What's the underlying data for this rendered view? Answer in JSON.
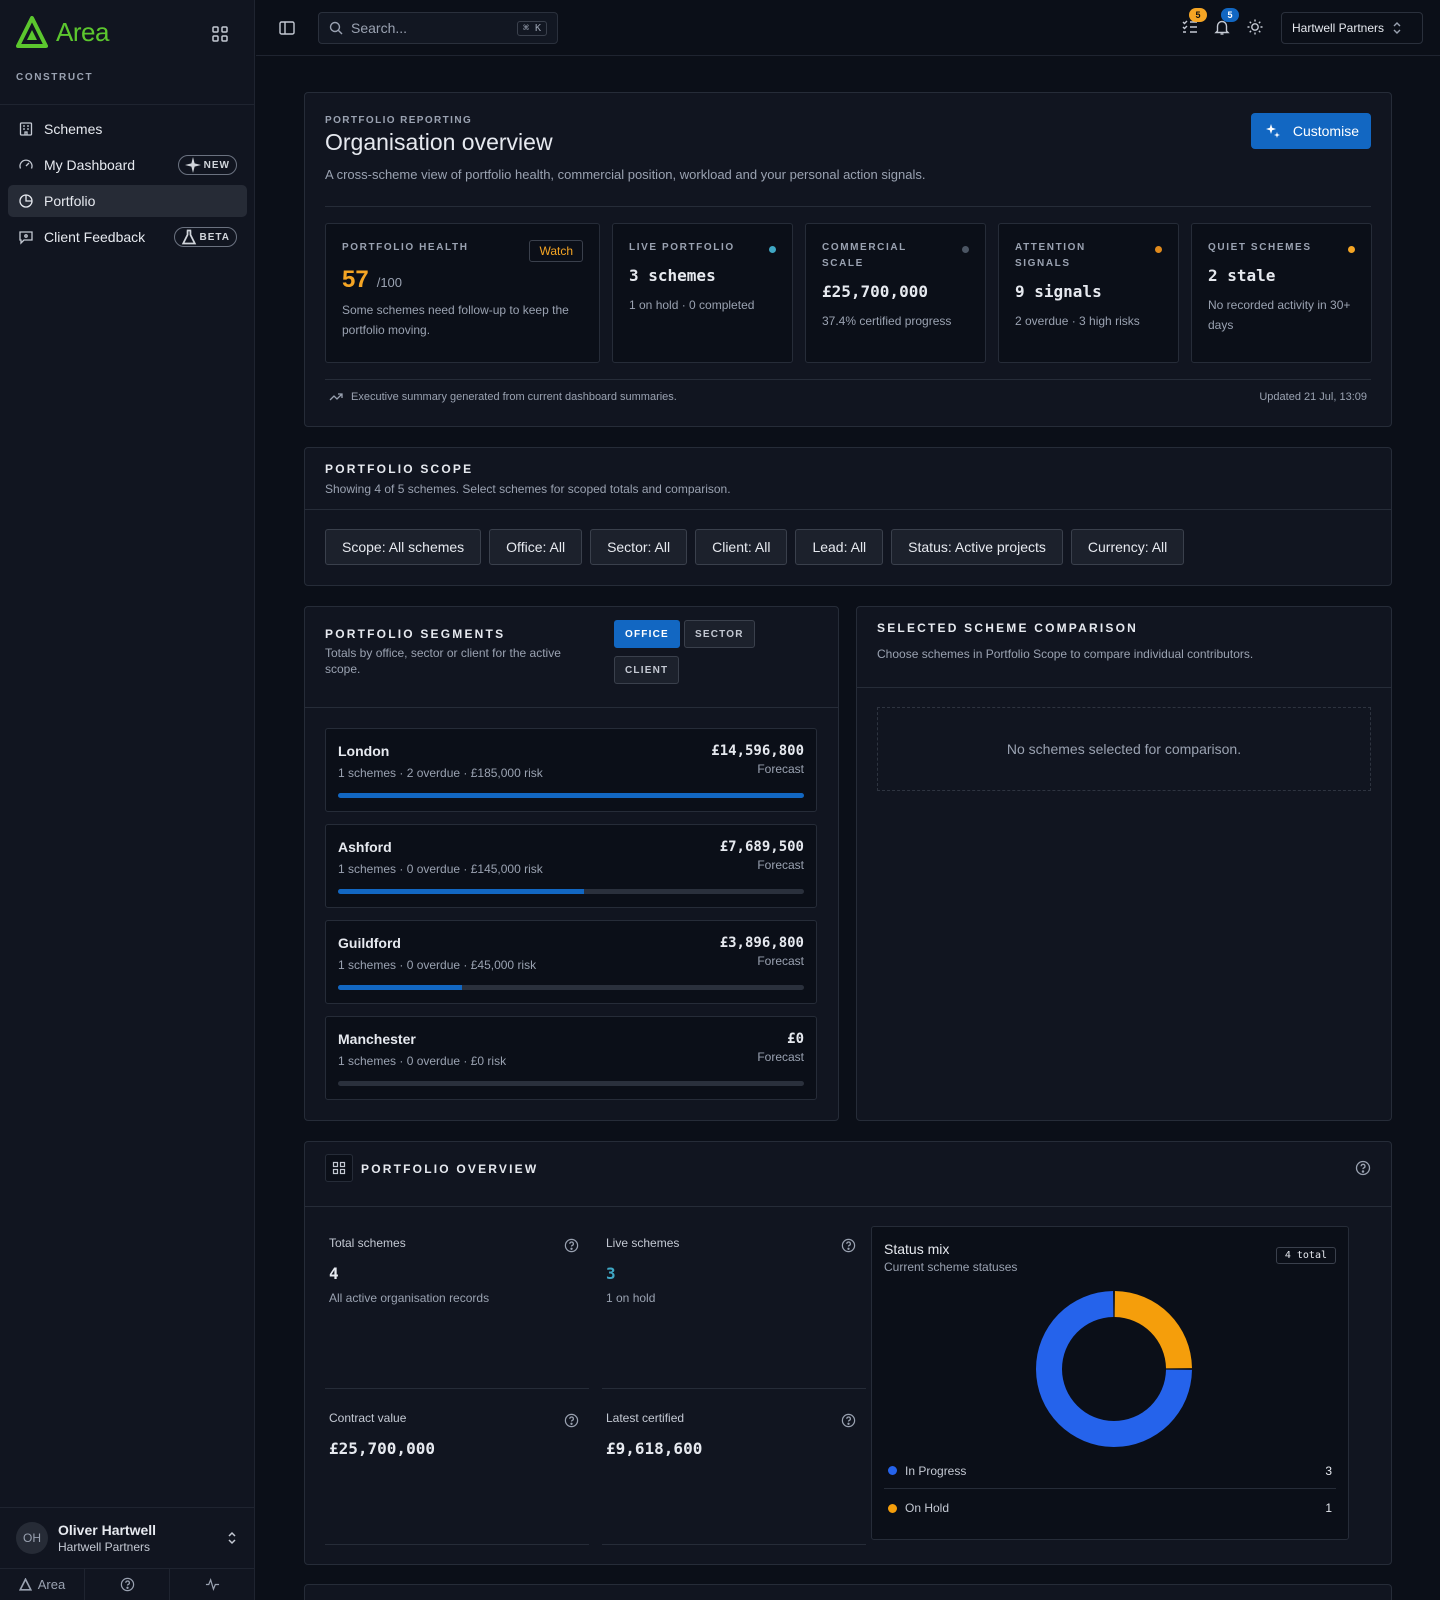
{
  "app": {
    "name": "Area",
    "subtitle": "CONSTRUCT"
  },
  "sidebar": {
    "items": [
      {
        "label": "Schemes",
        "icon": "building-icon"
      },
      {
        "label": "My Dashboard",
        "icon": "gauge-icon",
        "badge": "NEW"
      },
      {
        "label": "Portfolio",
        "icon": "pie-chart-icon",
        "active": true
      },
      {
        "label": "Client Feedback",
        "icon": "message-icon",
        "badge": "BETA"
      }
    ],
    "user": {
      "initials": "OH",
      "name": "Oliver Hartwell",
      "org": "Hartwell Partners"
    },
    "footer": {
      "app_label": "Area"
    }
  },
  "topbar": {
    "search_placeholder": "Search...",
    "search_shortcut": "⌘ K",
    "tasks_count": "5",
    "notifications_count": "5",
    "org": "Hartwell Partners"
  },
  "overview": {
    "eyebrow": "PORTFOLIO REPORTING",
    "title": "Organisation overview",
    "description": "A cross-scheme view of portfolio health, commercial position, workload and your personal action signals.",
    "customise_label": "Customise",
    "stats": {
      "health": {
        "label": "PORTFOLIO HEALTH",
        "badge": "Watch",
        "value": "57",
        "unit": "/100",
        "sub": "Some schemes need follow-up to keep the portfolio moving."
      },
      "live": {
        "label": "LIVE PORTFOLIO",
        "value": "3 schemes",
        "sub": "1 on hold · 0 completed",
        "dot_color": "#3fa7c4"
      },
      "commercial": {
        "label": "COMMERCIAL SCALE",
        "value": "£25,700,000",
        "sub": "37.4% certified progress",
        "dot_color": "#4b5563"
      },
      "attention": {
        "label": "ATTENTION SIGNALS",
        "value": "9 signals",
        "sub": "2 overdue · 3 high risks",
        "dot_color": "#e08a1c"
      },
      "quiet": {
        "label": "QUIET SCHEMES",
        "value": "2 stale",
        "sub": "No recorded activity in 30+ days",
        "dot_color": "#f5a524"
      }
    },
    "footer_text": "Executive summary generated from current dashboard summaries.",
    "updated": "Updated 21 Jul, 13:09"
  },
  "scope": {
    "title": "PORTFOLIO SCOPE",
    "subtitle": "Showing 4 of 5 schemes. Select schemes for scoped totals and comparison.",
    "chips": [
      "Scope: All schemes",
      "Office: All",
      "Sector: All",
      "Client: All",
      "Lead: All",
      "Status: Active projects",
      "Currency: All"
    ]
  },
  "segments": {
    "title": "PORTFOLIO SEGMENTS",
    "subtitle": "Totals by office, sector or client for the active scope.",
    "toggles": [
      "OFFICE",
      "SECTOR",
      "CLIENT"
    ],
    "forecast_label": "Forecast",
    "rows": [
      {
        "name": "London",
        "meta": "1 schemes · 2 overdue · £185,000 risk",
        "value": "£14,596,800",
        "fraction": 1.0
      },
      {
        "name": "Ashford",
        "meta": "1 schemes · 0 overdue · £145,000 risk",
        "value": "£7,689,500",
        "fraction": 0.527
      },
      {
        "name": "Guildford",
        "meta": "1 schemes · 0 overdue · £45,000 risk",
        "value": "£3,896,800",
        "fraction": 0.267
      },
      {
        "name": "Manchester",
        "meta": "1 schemes · 0 overdue · £0 risk",
        "value": "£0",
        "fraction": 0
      }
    ]
  },
  "comparison": {
    "title": "SELECTED SCHEME COMPARISON",
    "subtitle": "Choose schemes in Portfolio Scope to compare individual contributors.",
    "empty": "No schemes selected for comparison."
  },
  "portfolio_overview": {
    "title": "PORTFOLIO OVERVIEW",
    "metrics": {
      "total": {
        "label": "Total schemes",
        "value": "4",
        "sub": "All active organisation records"
      },
      "live": {
        "label": "Live schemes",
        "value": "3",
        "sub": "1 on hold"
      },
      "contract": {
        "label": "Contract value",
        "value": "£25,700,000"
      },
      "certified": {
        "label": "Latest certified",
        "value": "£9,618,600"
      }
    },
    "status_mix": {
      "title": "Status mix",
      "subtitle": "Current scheme statuses",
      "total": "4 total",
      "legend": [
        {
          "label": "In Progress",
          "count": "3",
          "color": "#2563eb"
        },
        {
          "label": "On Hold",
          "count": "1",
          "color": "#f59e0b"
        }
      ]
    }
  },
  "chart_data": {
    "type": "pie",
    "categories": [
      "In Progress",
      "On Hold"
    ],
    "values": [
      3,
      1
    ],
    "colors": [
      "#2563eb",
      "#f59e0b"
    ],
    "title": "Status mix"
  },
  "colors": {
    "accent": "#1267c2",
    "brand": "#5cc72e",
    "warning": "#f5a524"
  }
}
